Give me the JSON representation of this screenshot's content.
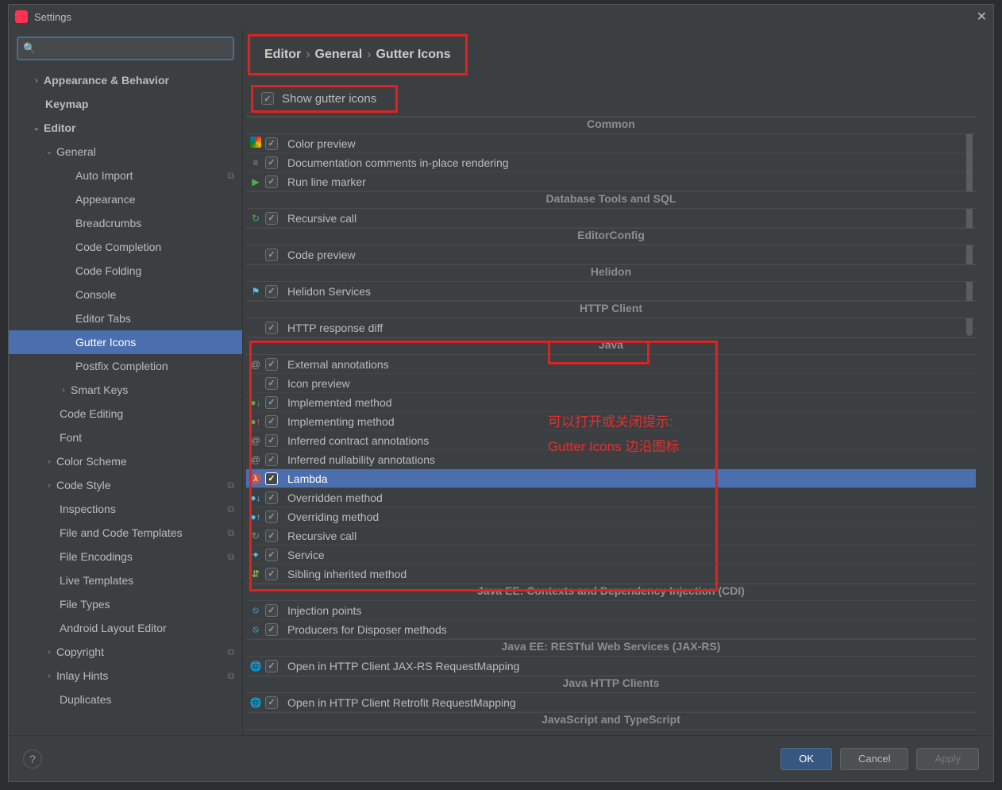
{
  "window": {
    "title": "Settings"
  },
  "search": {
    "placeholder": ""
  },
  "sidebar": {
    "items": [
      {
        "label": "Appearance & Behavior",
        "level": 1,
        "bold": true,
        "chev": "›"
      },
      {
        "label": "Keymap",
        "level": 2,
        "bold": true
      },
      {
        "label": "Editor",
        "level": 1,
        "bold": true,
        "chev": "⌄"
      },
      {
        "label": "General",
        "level": 2,
        "chev": "⌄"
      },
      {
        "label": "Auto Import",
        "level": 4,
        "link": true
      },
      {
        "label": "Appearance",
        "level": 4
      },
      {
        "label": "Breadcrumbs",
        "level": 4
      },
      {
        "label": "Code Completion",
        "level": 4
      },
      {
        "label": "Code Folding",
        "level": 4
      },
      {
        "label": "Console",
        "level": 4
      },
      {
        "label": "Editor Tabs",
        "level": 4
      },
      {
        "label": "Gutter Icons",
        "level": 4,
        "sel": true
      },
      {
        "label": "Postfix Completion",
        "level": 4
      },
      {
        "label": "Smart Keys",
        "level": 3,
        "chev": "›"
      },
      {
        "label": "Code Editing",
        "level": 3
      },
      {
        "label": "Font",
        "level": 3
      },
      {
        "label": "Color Scheme",
        "level": 2,
        "chev": "›"
      },
      {
        "label": "Code Style",
        "level": 2,
        "chev": "›",
        "link": true
      },
      {
        "label": "Inspections",
        "level": 3,
        "link": true
      },
      {
        "label": "File and Code Templates",
        "level": 3,
        "link": true
      },
      {
        "label": "File Encodings",
        "level": 3,
        "link": true
      },
      {
        "label": "Live Templates",
        "level": 3
      },
      {
        "label": "File Types",
        "level": 3
      },
      {
        "label": "Android Layout Editor",
        "level": 3
      },
      {
        "label": "Copyright",
        "level": 2,
        "chev": "›",
        "link": true
      },
      {
        "label": "Inlay Hints",
        "level": 2,
        "chev": "›",
        "link": true
      },
      {
        "label": "Duplicates",
        "level": 3
      }
    ]
  },
  "breadcrumb": {
    "p1": "Editor",
    "p2": "General",
    "p3": "Gutter Icons"
  },
  "show_gutter": {
    "label": "Show gutter icons",
    "checked": true
  },
  "sections": [
    {
      "header": "Common",
      "rows": [
        {
          "icon": "color",
          "label": "Color preview",
          "checked": true
        },
        {
          "icon": "doc",
          "label": "Documentation comments in-place rendering",
          "checked": true
        },
        {
          "icon": "play",
          "label": "Run line marker",
          "checked": true
        }
      ]
    },
    {
      "header": "Database Tools and SQL",
      "rows": [
        {
          "icon": "recur",
          "label": "Recursive call",
          "checked": true
        }
      ]
    },
    {
      "header": "EditorConfig",
      "rows": [
        {
          "icon": "blank",
          "label": "Code preview",
          "checked": true
        }
      ]
    },
    {
      "header": "Helidon",
      "rows": [
        {
          "icon": "flag",
          "label": "Helidon Services",
          "checked": true
        }
      ]
    },
    {
      "header": "HTTP Client",
      "rows": [
        {
          "icon": "blank",
          "label": "HTTP response diff",
          "checked": true
        }
      ]
    },
    {
      "header": "Java",
      "rows": [
        {
          "icon": "at",
          "label": "External annotations",
          "checked": true
        },
        {
          "icon": "blank",
          "label": "Icon preview",
          "checked": true
        },
        {
          "icon": "down",
          "label": "Implemented method",
          "checked": true
        },
        {
          "icon": "updown",
          "label": "Implementing method",
          "checked": true
        },
        {
          "icon": "at",
          "label": "Inferred contract annotations",
          "checked": true
        },
        {
          "icon": "at",
          "label": "Inferred nullability annotations",
          "checked": true
        },
        {
          "icon": "lambda",
          "label": "Lambda",
          "checked": true,
          "sel": true
        },
        {
          "icon": "override",
          "label": "Overridden method",
          "checked": true
        },
        {
          "icon": "override2",
          "label": "Overriding method",
          "checked": true
        },
        {
          "icon": "recur",
          "label": "Recursive call",
          "checked": true
        },
        {
          "icon": "service",
          "label": "Service",
          "checked": true
        },
        {
          "icon": "sibling",
          "label": "Sibling inherited method",
          "checked": true
        }
      ]
    },
    {
      "header": "Java EE: Contexts and Dependency Injection (CDI)",
      "rows": [
        {
          "icon": "ban",
          "label": "Injection points",
          "checked": true
        },
        {
          "icon": "ban",
          "label": "Producers for Disposer methods",
          "checked": true
        }
      ]
    },
    {
      "header": "Java EE: RESTful Web Services (JAX-RS)",
      "rows": [
        {
          "icon": "globe",
          "label": "Open in HTTP Client JAX-RS RequestMapping",
          "checked": true
        }
      ]
    },
    {
      "header": "Java HTTP Clients",
      "rows": [
        {
          "icon": "globe",
          "label": "Open in HTTP Client Retrofit RequestMapping",
          "checked": true
        }
      ]
    },
    {
      "header": "JavaScript and TypeScript",
      "rows": []
    }
  ],
  "annotation": {
    "line1": "可以打开或关闭提示:",
    "line2": "Gutter Icons 边沿图标"
  },
  "buttons": {
    "ok": "OK",
    "cancel": "Cancel",
    "apply": "Apply"
  }
}
